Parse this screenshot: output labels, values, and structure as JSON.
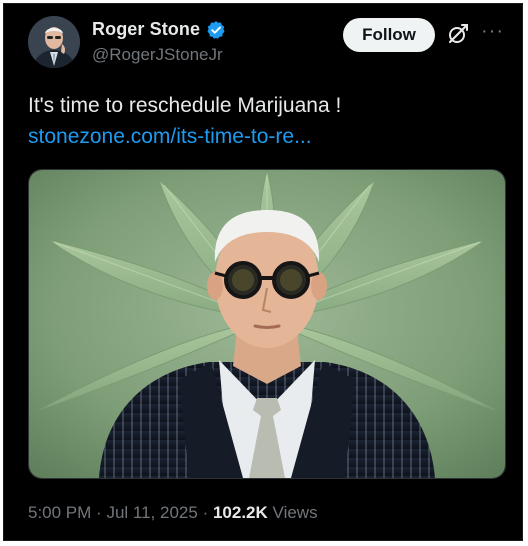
{
  "author": {
    "display_name": "Roger Stone",
    "handle": "@RogerJStoneJr",
    "verified": true,
    "avatar_icon": "profile-photo"
  },
  "actions": {
    "follow_label": "Follow",
    "grok_icon": "grok-icon",
    "more_icon": "more-options-icon",
    "more_glyph": "···"
  },
  "tweet": {
    "text": "It's time to reschedule Marijuana !",
    "link_text": "stonezone.com/its-time-to-re..."
  },
  "media": {
    "description_icon": "photo",
    "subject": "man-in-round-sunglasses-pinstripe-suit",
    "background": "cannabis-leaf"
  },
  "meta": {
    "time": "5:00 PM",
    "sep1": "·",
    "date": "Jul 11, 2025",
    "sep2": "·",
    "views_count": "102.2K",
    "views_label": "Views"
  },
  "colors": {
    "background": "#000000",
    "text_primary": "#e7e9ea",
    "text_secondary": "#71767b",
    "link": "#1d9bf0",
    "verified_badge": "#1d9bf0",
    "follow_button_bg": "#eff3f4"
  }
}
